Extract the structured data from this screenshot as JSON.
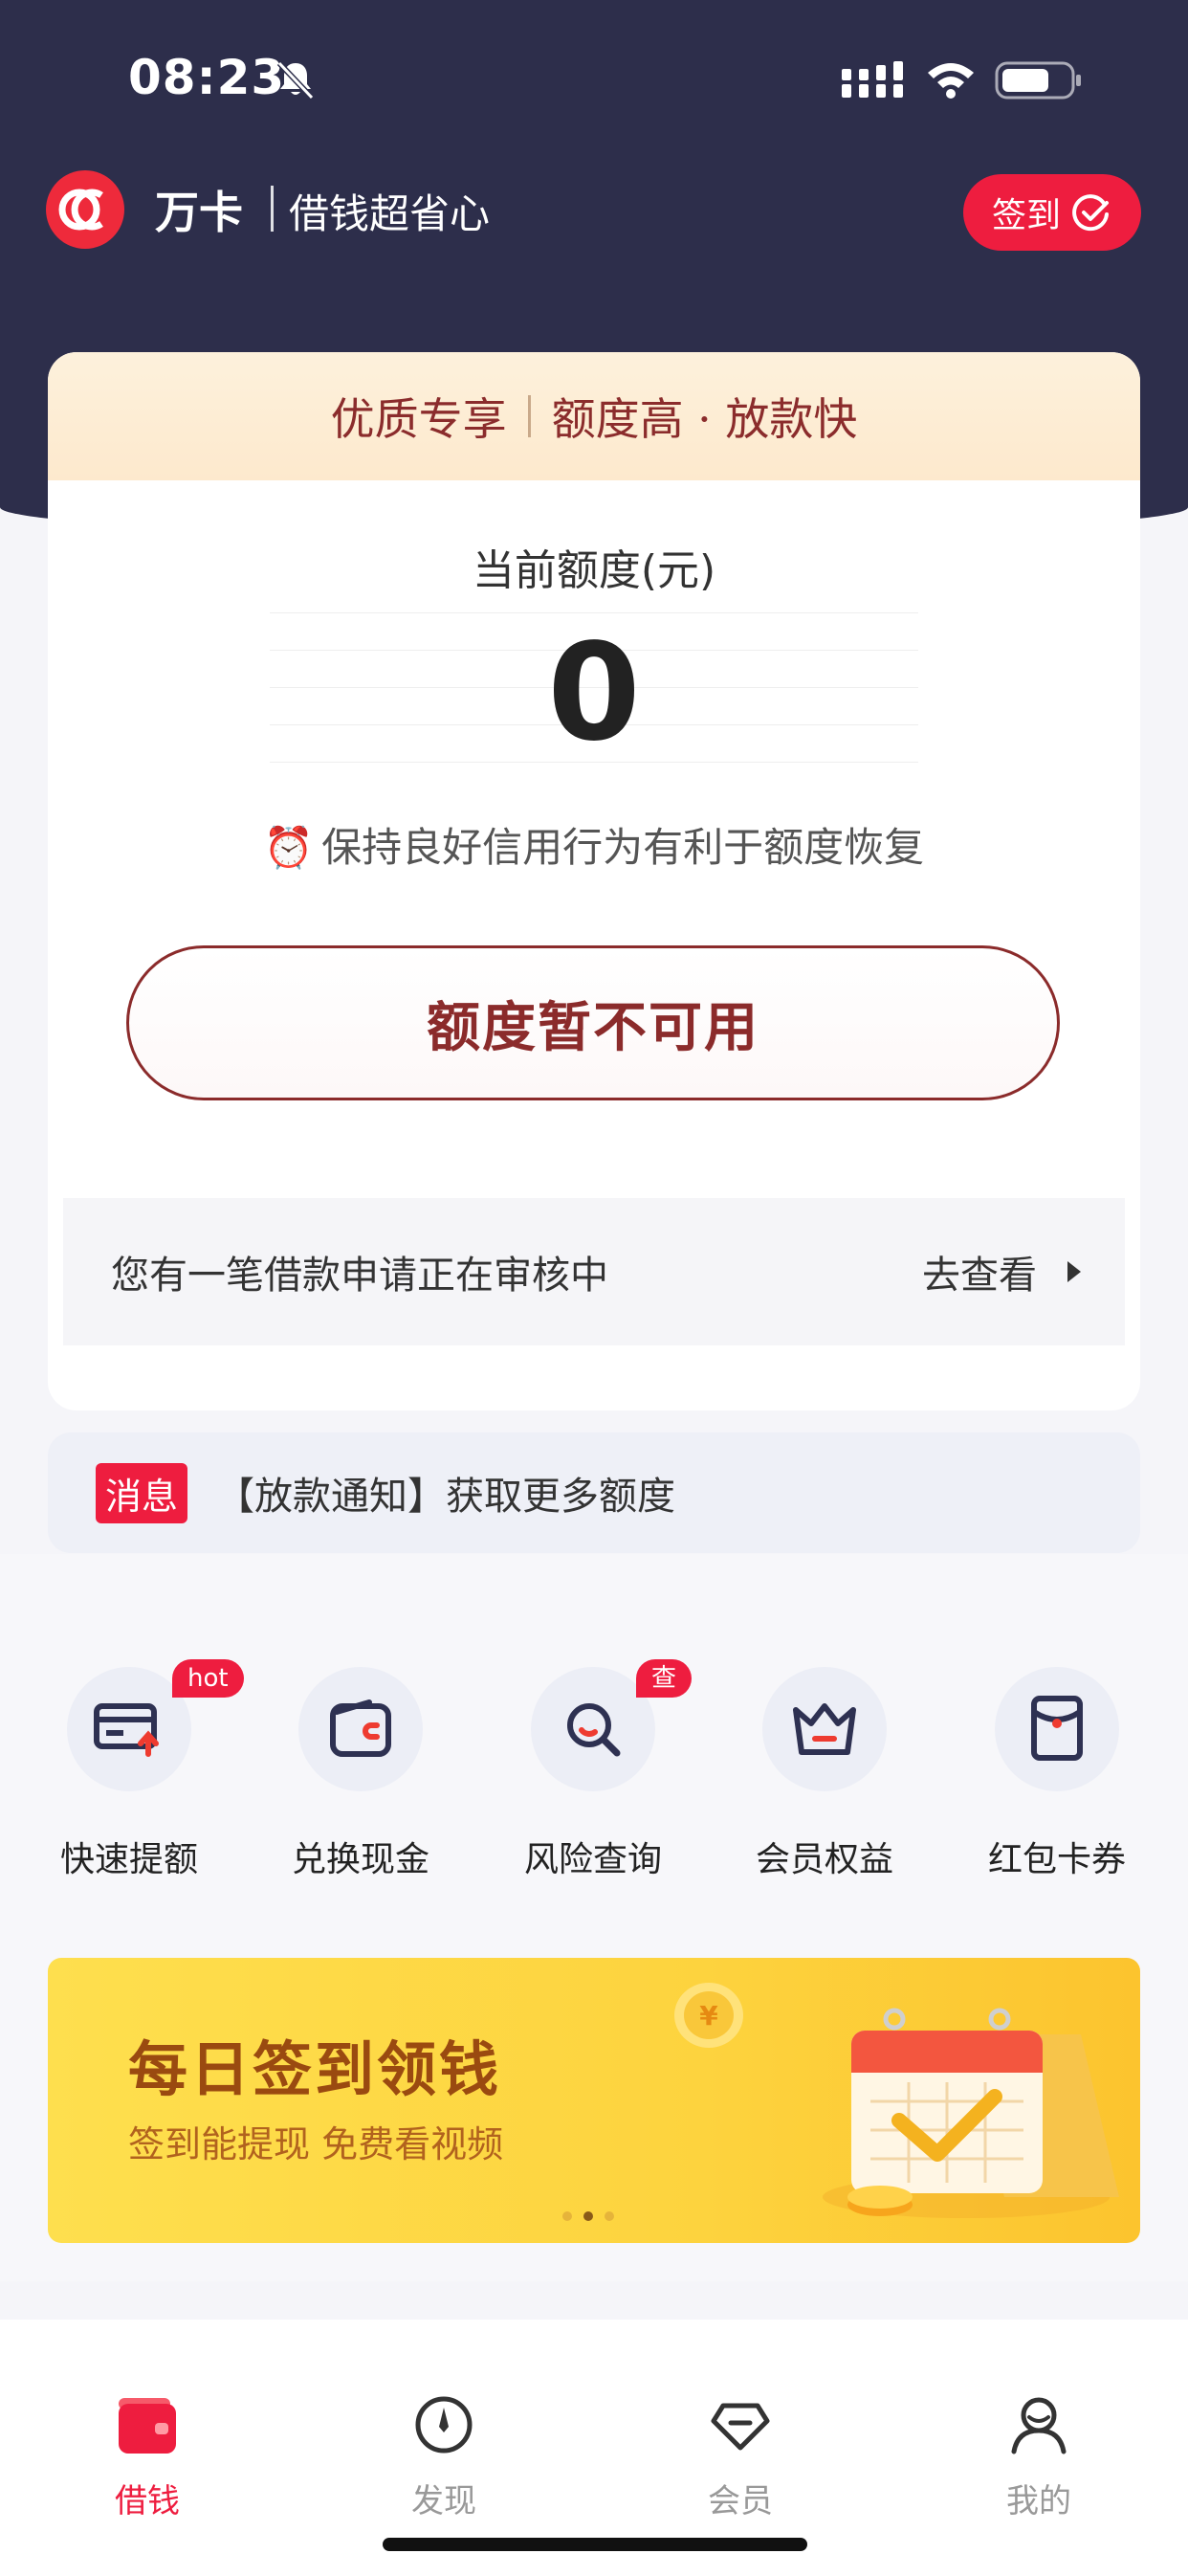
{
  "status_bar": {
    "time": "08:23"
  },
  "header": {
    "brand": "万卡",
    "slogan": "借钱超省心",
    "signin_label": "签到"
  },
  "colors": {
    "navy": "#2d2e4b",
    "brand_red": "#ee1d3f",
    "maroon": "#8b2b2b",
    "banner_gold": "#fde9cd"
  },
  "card": {
    "banner_left": "优质专享",
    "banner_right": "额度高 · 放款快",
    "quota_label": "当前额度(元)",
    "quota_value": "0",
    "tip_icon": "⏰",
    "tip": "保持良好信用行为有利于额度恢复",
    "quota_button": "额度暂不可用",
    "review_text": "您有一笔借款申请正在审核中",
    "review_link": "去查看"
  },
  "message": {
    "badge": "消息",
    "text": "【放款通知】获取更多额度"
  },
  "quick_actions": [
    {
      "label": "快速提额",
      "icon": "card-upgrade-icon",
      "tag": "hot"
    },
    {
      "label": "兑换现金",
      "icon": "wallet-icon",
      "tag": ""
    },
    {
      "label": "风险查询",
      "icon": "search-icon",
      "tag": "查"
    },
    {
      "label": "会员权益",
      "icon": "crown-icon",
      "tag": ""
    },
    {
      "label": "红包卡券",
      "icon": "red-envelope-icon",
      "tag": ""
    }
  ],
  "promo": {
    "title": "每日签到领钱",
    "subtitle": "签到能提现 免费看视频",
    "carousel_pages": 3,
    "carousel_active": 2
  },
  "tabbar": [
    {
      "label": "借钱",
      "icon": "wallet-icon",
      "active": true
    },
    {
      "label": "发现",
      "icon": "compass-icon",
      "active": false
    },
    {
      "label": "会员",
      "icon": "diamond-icon",
      "active": false
    },
    {
      "label": "我的",
      "icon": "user-icon",
      "active": false
    }
  ]
}
